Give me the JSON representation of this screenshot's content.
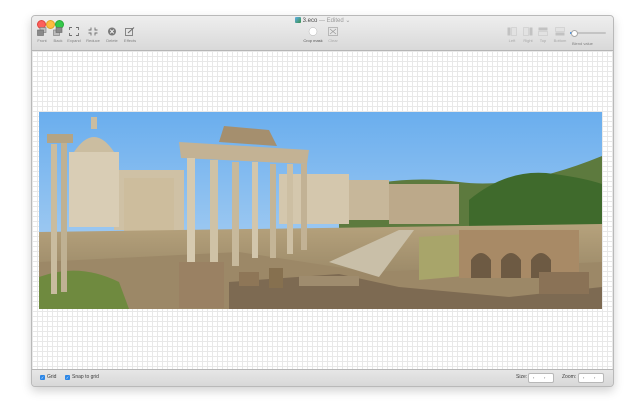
{
  "window": {
    "title": "3.eco",
    "edited": "— Edited ⌄"
  },
  "toolbar": {
    "left": [
      {
        "label": "Front",
        "icon": "bring-front-icon"
      },
      {
        "label": "Back",
        "icon": "send-back-icon"
      },
      {
        "label": "Expand",
        "icon": "expand-icon"
      },
      {
        "label": "Reduce",
        "icon": "reduce-icon"
      },
      {
        "label": "Delete",
        "icon": "delete-icon"
      },
      {
        "label": "Effects",
        "icon": "effects-icon"
      }
    ],
    "center": [
      {
        "label": "Crop mask",
        "icon": "crop-mask-icon"
      },
      {
        "label": "Clear",
        "icon": "clear-icon"
      }
    ],
    "right": [
      {
        "label": "Left",
        "icon": "align-left-icon"
      },
      {
        "label": "Right",
        "icon": "align-right-icon"
      },
      {
        "label": "Top",
        "icon": "align-top-icon"
      },
      {
        "label": "Bottom",
        "icon": "align-bottom-icon"
      }
    ],
    "blend_label": "Blend value",
    "blend_value": 0.1
  },
  "statusbar": {
    "grid_label": "Grid",
    "grid_checked": true,
    "snap_label": "Snap to grid",
    "snap_checked": true,
    "size_label": "Size:",
    "zoom_label": "Zoom:"
  },
  "colors": {
    "accent": "#2b86e6",
    "sky": "#7ab7ee",
    "stone": "#c9b89a"
  }
}
